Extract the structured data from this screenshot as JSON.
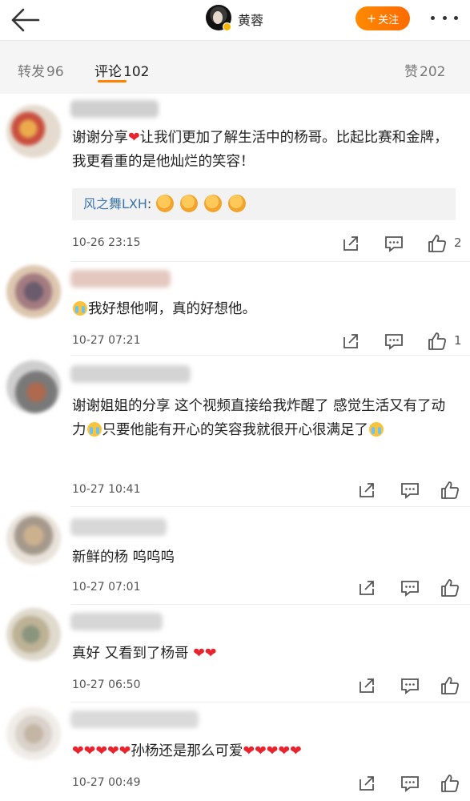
{
  "header": {
    "username": "黄蓉",
    "follow_label": "关注",
    "follow_plus": "+"
  },
  "tabs": {
    "repost_label": "转发",
    "repost_count": "96",
    "comment_label": "评论",
    "comment_count": "102",
    "like_label": "赞",
    "like_count": "202"
  },
  "comments": [
    {
      "text_part1": "谢谢分享",
      "heart": "❤",
      "text_part2": "让我们更加了解生活中的杨哥。比起比赛和金牌，我更看重的是他灿烂的笑容！",
      "reply_user": "风之舞LXH",
      "reply_sep": ":",
      "reply_thumbs": 4,
      "time": "10-26 23:15",
      "like_count": "2"
    },
    {
      "text": "我好想他啊，真的好想他。",
      "time": "10-27 07:21",
      "like_count": "1"
    },
    {
      "text_part1": "谢谢姐姐的分享 这个视频直接给我炸醒了 感觉生活又有了动力",
      "text_part2": "只要他能有开心的笑容我就很开心很满足了",
      "time": "10-27 10:41"
    },
    {
      "text": "新鲜的杨 呜呜呜",
      "time": "10-27 07:01"
    },
    {
      "text": "真好 又看到了杨哥 ",
      "hearts": "❤❤",
      "time": "10-27 06:50"
    },
    {
      "hearts_before": "❤❤❤❤❤",
      "text": "孙杨还是那么可爱",
      "hearts_after": "❤❤❤❤❤",
      "time": "10-27 00:49"
    }
  ],
  "colors": {
    "accent_orange": "#ff8200",
    "reply_link_blue": "#3a74ae",
    "heart_red": "#e8232d"
  },
  "icons": [
    "back-arrow-icon",
    "vip-badge-icon",
    "more-dots-icon",
    "share-icon",
    "comment-icon",
    "thumbs-up-icon",
    "crying-face-emoji",
    "thumbs-up-emoji",
    "red-heart-emoji"
  ]
}
